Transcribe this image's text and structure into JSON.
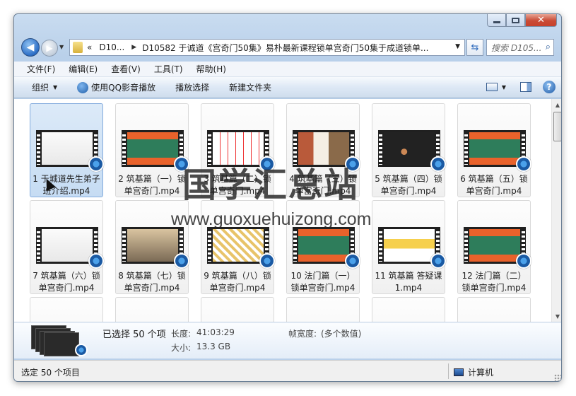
{
  "window": {
    "controls": {
      "close_glyph": "✕"
    }
  },
  "nav": {
    "back_glyph": "◀",
    "forward_glyph": "▶",
    "breadcrumbs": [
      "«",
      "D10...",
      "D10582 于诚道《宫奇门50集》易朴最新课程锁单宫奇门50集于成道锁单..."
    ],
    "search_placeholder": "搜索 D105..."
  },
  "menubar": [
    "文件(F)",
    "编辑(E)",
    "查看(V)",
    "工具(T)",
    "帮助(H)"
  ],
  "commandbar": {
    "organize": "组织",
    "play_with_qq": "使用QQ影音播放",
    "play_selection": "播放选择",
    "new_folder": "新建文件夹"
  },
  "files": [
    {
      "name": "1 于城道先生弟子班介绍.mp4",
      "thumb": "white",
      "selected": true
    },
    {
      "name": "2 筑基篇（一）锁单宫奇门.mp4",
      "thumb": "green"
    },
    {
      "name": "3 筑基篇（二）锁单宫奇门.mp4",
      "thumb": "whiteboard"
    },
    {
      "name": "4 筑基篇（三）锁单宫奇门.mp4",
      "thumb": "photo"
    },
    {
      "name": "5 筑基篇（四）锁单宫奇门.mp4",
      "thumb": "dark"
    },
    {
      "name": "6 筑基篇（五）锁单宫奇门.mp4",
      "thumb": "green"
    },
    {
      "name": "7 筑基篇（六）锁单宫奇门.mp4",
      "thumb": "white"
    },
    {
      "name": "8 筑基篇（七）锁单宫奇门.mp4",
      "thumb": "class"
    },
    {
      "name": "9 筑基篇（八）锁单宫奇门.mp4",
      "thumb": "chart"
    },
    {
      "name": "10 法门篇（一）锁单宫奇门.mp4",
      "thumb": "green"
    },
    {
      "name": "11 筑基篇 答疑课1.mp4",
      "thumb": "slide"
    },
    {
      "name": "12 法门篇（二）锁单宫奇门.mp4",
      "thumb": "green"
    }
  ],
  "details": {
    "selected": "已选择 50 个项",
    "duration_label": "长度:",
    "duration_value": "41:03:29",
    "size_label": "大小:",
    "size_value": "13.3 GB",
    "framewidth_label": "帧宽度:",
    "framewidth_value": "(多个数值)"
  },
  "statusbar": {
    "left": "选定 50 个项目",
    "computer": "计算机"
  },
  "watermark": {
    "cn": "国学汇总站",
    "url": "www.guoxuehuizong.com"
  },
  "colors": {
    "accent": "#2c6ec6",
    "selection": "#c6dcf3",
    "thumb_green": "#2e7d5b",
    "thumb_orange": "#e9622b"
  }
}
